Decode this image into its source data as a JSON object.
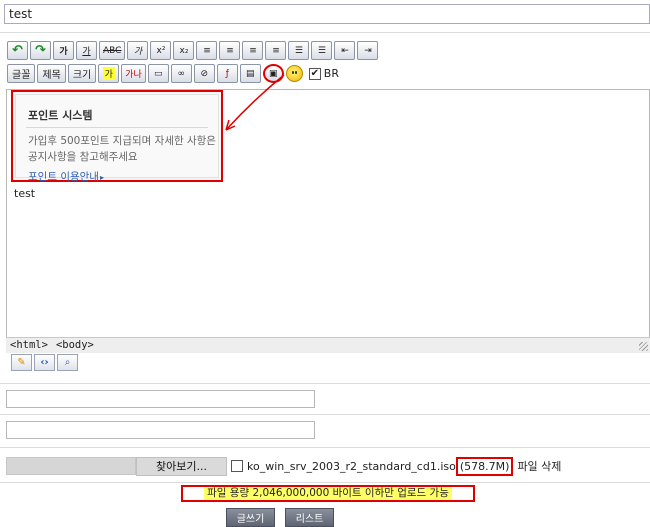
{
  "subject": {
    "value": "test"
  },
  "toolbar": {
    "row1": [
      {
        "name": "undo-icon",
        "glyph": "↶",
        "style": "green"
      },
      {
        "name": "redo-icon",
        "glyph": "↷",
        "style": "green"
      },
      {
        "name": "bold-button",
        "glyph": "가",
        "style": "bold"
      },
      {
        "name": "underline-button",
        "glyph": "가",
        "style": "underline"
      },
      {
        "name": "strike-button",
        "glyph": "ABC",
        "style": "strike"
      },
      {
        "name": "italic-button",
        "glyph": "가",
        "style": "italic"
      },
      {
        "name": "superscript-button",
        "glyph": "x²",
        "style": ""
      },
      {
        "name": "subscript-button",
        "glyph": "x₂",
        "style": ""
      },
      {
        "name": "align-left-icon",
        "glyph": "≡",
        "style": ""
      },
      {
        "name": "align-center-icon",
        "glyph": "≡",
        "style": ""
      },
      {
        "name": "align-right-icon",
        "glyph": "≡",
        "style": ""
      },
      {
        "name": "align-justify-icon",
        "glyph": "≡",
        "style": ""
      },
      {
        "name": "ordered-list-icon",
        "glyph": "☰",
        "style": ""
      },
      {
        "name": "unordered-list-icon",
        "glyph": "☰",
        "style": ""
      },
      {
        "name": "outdent-icon",
        "glyph": "⇤",
        "style": ""
      },
      {
        "name": "indent-icon",
        "glyph": "⇥",
        "style": ""
      }
    ],
    "row2_text": [
      {
        "name": "font-button",
        "label": "글꼴"
      },
      {
        "name": "heading-button",
        "label": "제목"
      },
      {
        "name": "size-button",
        "label": "크기"
      }
    ],
    "row2_icons": [
      {
        "name": "text-color-icon",
        "glyph": "가",
        "style": "yellow"
      },
      {
        "name": "background-color-icon",
        "glyph": "가나",
        "style": "red"
      },
      {
        "name": "table-icon",
        "glyph": "▭",
        "style": ""
      },
      {
        "name": "link-icon",
        "glyph": "∞",
        "style": ""
      },
      {
        "name": "unlink-icon",
        "glyph": "⊘",
        "style": ""
      },
      {
        "name": "flash-icon",
        "glyph": "ƒ",
        "style": "red"
      },
      {
        "name": "image-icon",
        "glyph": "▤",
        "style": ""
      },
      {
        "name": "point-system-icon",
        "glyph": "▣",
        "style": "sel"
      }
    ],
    "br_label": "BR",
    "br_checked": "✔"
  },
  "popup": {
    "title": "포인트 시스템",
    "body": "가입후   500포인트 지급되며 자세한 사항은 공지사항을 참고해주세요",
    "link": "포인트 이용안내"
  },
  "editor": {
    "content": "test",
    "status_html": "<html>",
    "status_body": "<body>"
  },
  "file": {
    "browse_label": "찾아보기...",
    "filename": "ko_win_srv_2003_r2_standard_cd1.iso",
    "size": "(578.7M)",
    "delete_label": "파일 삭제"
  },
  "notice": {
    "text": "파일 용량 2,046,000,000 바이트 이하만 업로드 가능"
  },
  "actions": {
    "write_label": "글쓰기",
    "list_label": "리스트"
  },
  "colors": {
    "annotation": "#e00000",
    "highlight": "#ffff66",
    "link": "#2f5fb3"
  }
}
